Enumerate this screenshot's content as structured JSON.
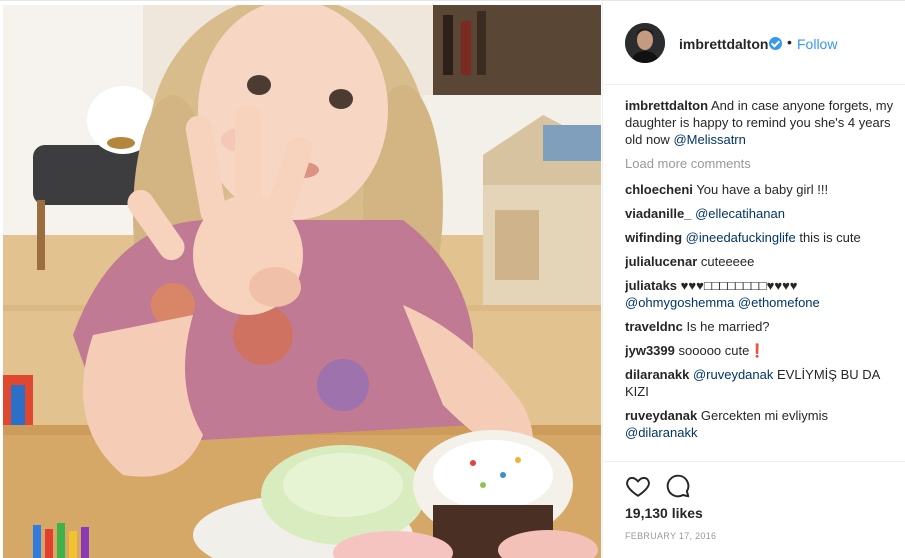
{
  "post": {
    "username": "imbrettdalton",
    "separator": "•",
    "follow_label": "Follow",
    "caption_username": "imbrettdalton",
    "caption_text": "And in case anyone forgets, my daughter is happy to remind you she's 4 years old now",
    "caption_mention": "@Melissatrn",
    "load_more_label": "Load more comments",
    "likes": "19,130 likes",
    "date": "FEBRUARY 17, 2016"
  },
  "comments": [
    {
      "user": "chloecheni",
      "text": "You have a baby girl !!!",
      "mention": ""
    },
    {
      "user": "viadanille_",
      "text": "",
      "mention": "@ellecatihanan"
    },
    {
      "user": "wifinding",
      "text": "this is cute",
      "mention": "@ineedafuckinglife"
    },
    {
      "user": "julialucenar",
      "text": "cuteeeee",
      "mention": ""
    },
    {
      "user": "juliataks",
      "text": "♥♥♥□□□□□□□□♥♥♥♥",
      "mention": "@ohmygoshemma @ethomefone"
    },
    {
      "user": "traveldnc",
      "text": "Is he married?",
      "mention": ""
    },
    {
      "user": "jyw3399",
      "text": "sooooo cute❗",
      "mention": ""
    },
    {
      "user": "dilaranakk",
      "text": "EVLİYMİŞ BU DA KIZI",
      "mention": "@ruveydanak"
    },
    {
      "user": "ruveydanak",
      "text": "Gercekten mi evliymis",
      "mention": "@dilaranakk"
    }
  ],
  "icons": {
    "heart": "heart-icon",
    "comment": "comment-icon",
    "verified": "verified-badge-icon"
  },
  "colors": {
    "link": "#3897f0",
    "mention": "#003569",
    "muted": "#999999",
    "text": "#262626"
  }
}
